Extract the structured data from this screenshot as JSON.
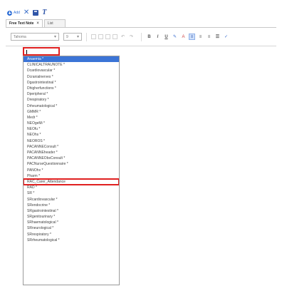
{
  "toolbar": {
    "add_label": "Add"
  },
  "tabs": [
    {
      "label": "Free Text Note",
      "close": "×"
    },
    {
      "label": "List"
    }
  ],
  "format_bar": {
    "font": "Tahoma",
    "size": "9",
    "bold": "B",
    "italic": "I",
    "underline": "U"
  },
  "dropdown": {
    "items": [
      "Anaemia *",
      "CLINICALTRAUNOTE *",
      "Dcardiovascular *",
      "Dcranialnerves *",
      "Dgastrointestinal *",
      "Dhigherfunctions *",
      "Dperipheral *",
      "Drespiratory *",
      "Drheumatological *",
      "GMMR *",
      "Medr *",
      "NEOgeMi *",
      "NEOfu *",
      "NEOhs *",
      "NEOROS *",
      "PACANNEConsult *",
      "PACANNEheader *",
      "PACANNEObsConsult *",
      "PACNurseQuestionnaire *",
      "PANOhx *",
      "Pharm *",
      "RAC_Carer_Attendance",
      "RAD *",
      "SR *",
      "SRcardiovascular *",
      "SRendocrine *",
      "SRgastrointestinal *",
      "SRgenitourinary *",
      "SRhaematological *",
      "SRneurological *",
      "SRrespiratory *",
      "SRrheumatological *"
    ],
    "selected_index": 0,
    "boxed_index": 21
  },
  "colors": {
    "highlight": "#3b74d6",
    "annotation": "#e02020"
  }
}
